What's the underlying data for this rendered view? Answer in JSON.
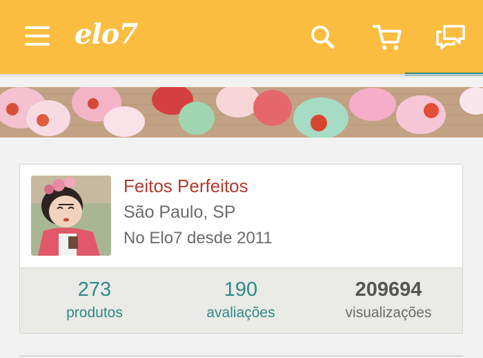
{
  "header": {
    "logo": "elo7",
    "background_color": "#fbbd40",
    "icons": [
      "menu-icon",
      "search-icon",
      "cart-icon",
      "chat-icon"
    ]
  },
  "store": {
    "name": "Feitos Perfeitos",
    "location": "São Paulo, SP",
    "since": "No Elo7 desde 2011",
    "name_color": "#b33a2c"
  },
  "stats": [
    {
      "value": "273",
      "label": "produtos"
    },
    {
      "value": "190",
      "label": "avaliações"
    },
    {
      "value": "209694",
      "label": "visualizações"
    }
  ],
  "accent_color": "#2e8a86"
}
